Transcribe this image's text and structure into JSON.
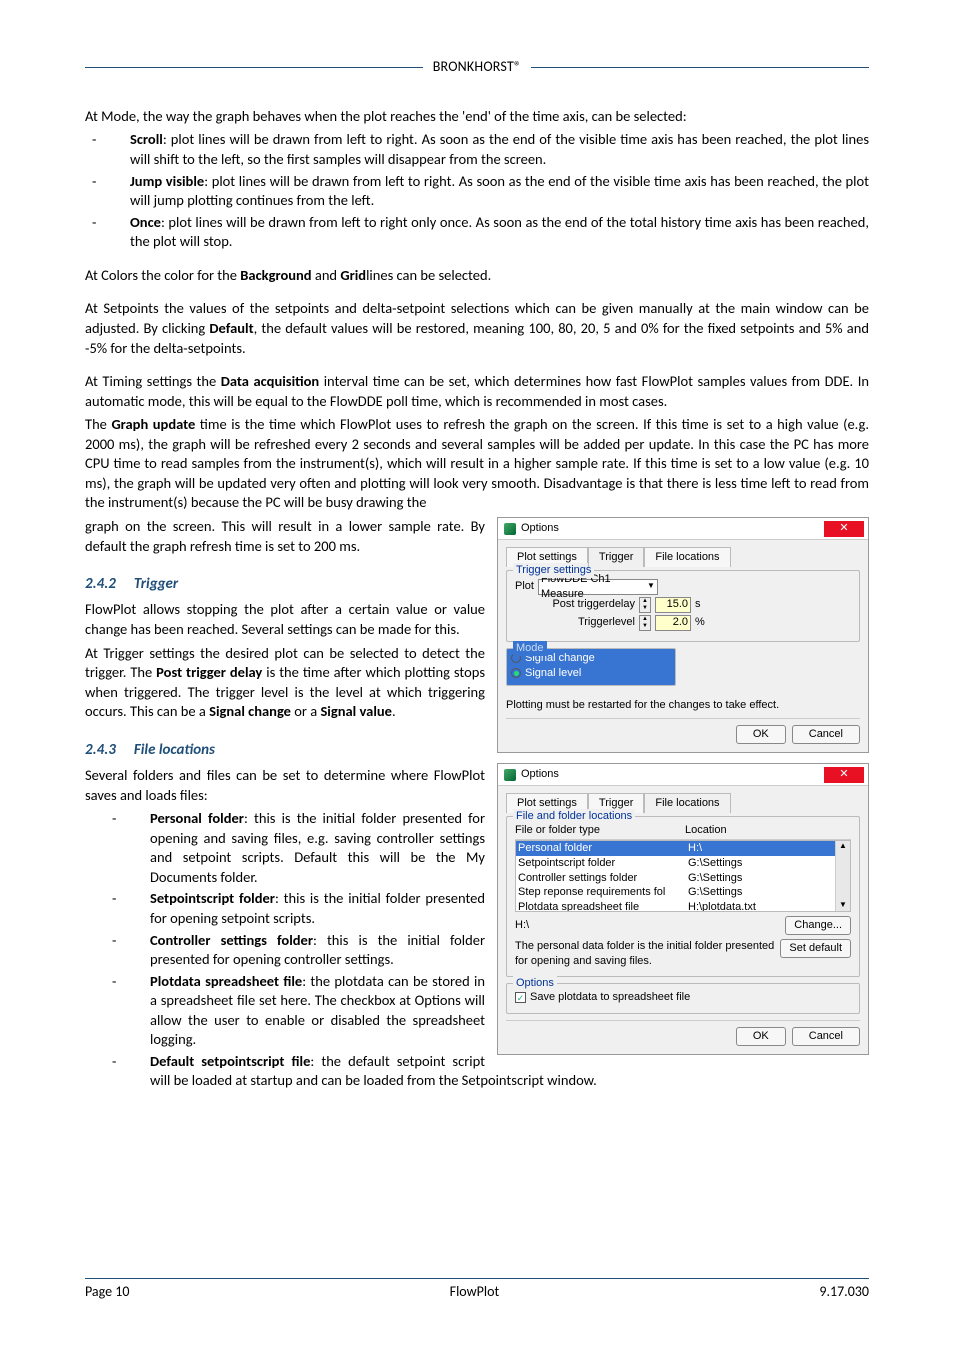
{
  "header": {
    "brand": "BRONKHORST®"
  },
  "intro": {
    "mode_line": "At Mode, the way the graph behaves when the plot reaches the 'end' of the time axis, can be selected:",
    "bullets": [
      {
        "b": "Scroll",
        "t": ": plot lines will be drawn from left to right. As soon as the end of the visible time axis has been reached, the plot lines will shift to the left, so the first samples will disappear from the screen."
      },
      {
        "b": "Jump visible",
        "t": ": plot lines will be drawn from left to right. As soon as the end of the visible time axis has been reached, the plot will jump plotting continues from the left."
      },
      {
        "b": "Once",
        "t": ": plot lines will be drawn from left to right only once. As soon as the end of the total history time axis has been reached, the plot will stop."
      }
    ],
    "colors_line_pre": "At Colors the color for the ",
    "colors_b1": "Background",
    "colors_mid": " and ",
    "colors_b2": "Grid",
    "colors_line_post": "lines can be selected.",
    "setpoints_pre": "At Setpoints the values of the setpoints and delta-setpoint selections which can be given manually at the main window can be adjusted. By clicking ",
    "setpoints_b": "Default",
    "setpoints_post": ", the default values will be restored, meaning 100, 80, 20, 5 and 0% for the fixed setpoints and 5% and -5% for the delta-setpoints.",
    "timing1_pre": "At Timing settings the ",
    "timing1_b": "Data acquisition",
    "timing1_post": " interval time can be set, which determines how fast FlowPlot samples values from DDE. In automatic mode, this will be equal to the FlowDDE poll time, which is recommended in most cases.",
    "timing2_pre": "The ",
    "timing2_b": "Graph update",
    "timing2_post": " time is the time which FlowPlot uses to refresh the graph on the screen. If this time is set to a high value (e.g. 2000 ms), the graph will be refreshed every 2 seconds and several samples will be added per update. In this case the PC has more CPU time to read samples from the instrument(s), which will result in a higher sample rate. If this time is set to a low value (e.g. 10 ms), the graph will be updated very often and plotting will look very smooth. Disadvantage is that there is less time left to read from the instrument(s) because the PC will be busy drawing the",
    "timing_wrap": "graph on the screen. This will result in a lower sample rate. By default the graph refresh time is set to 200 ms."
  },
  "sec_trigger": {
    "num": "2.4.2",
    "title": "Trigger",
    "p1": "FlowPlot allows stopping the plot after a certain value or value change has been reached. Several settings can be made for this.",
    "p2_pre": "At Trigger settings the desired plot can be selected to detect the trigger. The ",
    "p2_b1": "Post trigger delay",
    "p2_mid": " is the time after which plotting stops when triggered. The trigger level is the level at which triggering occurs. This can be a ",
    "p2_b2": "Signal change",
    "p2_or": " or a ",
    "p2_b3": "Signal value",
    "p2_end": "."
  },
  "sec_files": {
    "num": "2.4.3",
    "title": "File locations",
    "intro": "Several folders and files can be set to determine where FlowPlot saves and loads files:",
    "bullets": [
      {
        "b": "Personal folder",
        "t": ": this is the initial folder presented for opening and saving files, e.g. saving controller settings and setpoint scripts. Default this will be the My Documents folder."
      },
      {
        "b": "Setpointscript folder",
        "t": ": this is the initial folder presented for opening setpoint scripts."
      },
      {
        "b": "Controller settings folder",
        "t": ": this is the initial folder presented for opening controller settings."
      },
      {
        "b": "Plotdata spreadsheet file",
        "t": ": the plotdata can be stored in a spreadsheet file set here. The checkbox at Options will allow the user to enable or disabled the spreadsheet logging."
      },
      {
        "b": "Default setpointscript file",
        "t": ": the default setpoint script will be loaded at startup and can be loaded from the Setpointscript window."
      }
    ]
  },
  "dlg1": {
    "title": "Options",
    "tabs": [
      "Plot settings",
      "Trigger",
      "File locations"
    ],
    "group1": "Trigger settings",
    "plot_lbl": "Plot",
    "plot_val": "FlowDDE Ch1 Measure",
    "delay_lbl": "Post triggerdelay",
    "delay_val": "15.0",
    "delay_unit": "s",
    "level_lbl": "Triggerlevel",
    "level_val": "2.0",
    "level_unit": "%",
    "group2": "Mode",
    "radio1": "Signal change",
    "radio2": "Signal level",
    "note": "Plotting must be restarted for the changes to take effect.",
    "ok": "OK",
    "cancel": "Cancel"
  },
  "dlg2": {
    "title": "Options",
    "tabs": [
      "Plot settings",
      "Trigger",
      "File locations"
    ],
    "group1": "File and folder locations",
    "head1": "File or folder type",
    "head2": "Location",
    "rows": [
      {
        "a": "Personal folder",
        "b": "H:\\"
      },
      {
        "a": "Setpointscript folder",
        "b": "G:\\Settings"
      },
      {
        "a": "Controller settings folder",
        "b": "G:\\Settings"
      },
      {
        "a": "Step reponse requirements fol",
        "b": "G:\\Settings"
      },
      {
        "a": "Plotdata spreadsheet file",
        "b": "H:\\plotdata.txt"
      }
    ],
    "path": "H:\\",
    "change": "Change...",
    "desc": "The personal data folder is the initial folder presented for opening and saving files.",
    "setdef": "Set default",
    "group2": "Options",
    "check": "Save plotdata to spreadsheet file",
    "ok": "OK",
    "cancel": "Cancel"
  },
  "footer": {
    "left": "Page 10",
    "center": "FlowPlot",
    "right": "9.17.030"
  }
}
